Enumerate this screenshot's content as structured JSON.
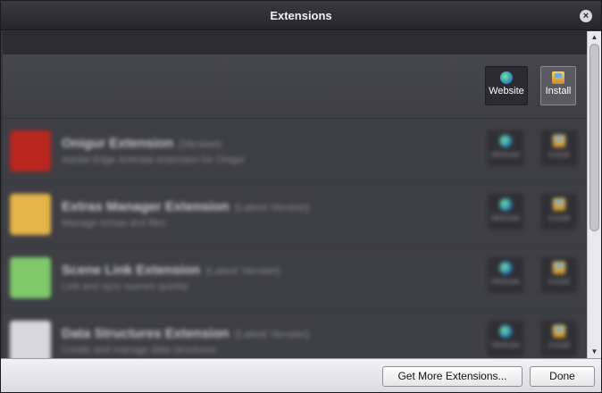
{
  "window": {
    "title": "Extensions",
    "close_glyph": "×"
  },
  "toolbar": {
    "website_label": "Website",
    "install_label": "Install",
    "website_icon": "globe-icon",
    "install_icon": "package-icon"
  },
  "extensions": [
    {
      "name": "Onigur Extension",
      "version": "(Version)",
      "description": "Adobe Edge Animate extension for Onigur",
      "icon_color": "#b8261e"
    },
    {
      "name": "Extras Manager Extension",
      "version": "(Latest Version)",
      "description": "Manage extras and files",
      "icon_color": "#e6b54a"
    },
    {
      "name": "Scene Link Extension",
      "version": "(Latest Version)",
      "description": "Link and sync scenes quickly",
      "icon_color": "#7fc96b"
    },
    {
      "name": "Data Structures Extension",
      "version": "(Latest Version)",
      "description": "Create and manage data structures",
      "icon_color": "#d8d8dc"
    }
  ],
  "row_buttons": {
    "website_label": "Website",
    "install_label": "Install"
  },
  "footer": {
    "more_label": "Get More Extensions...",
    "done_label": "Done"
  },
  "scrollbar": {
    "up_glyph": "▲",
    "down_glyph": "▼"
  }
}
